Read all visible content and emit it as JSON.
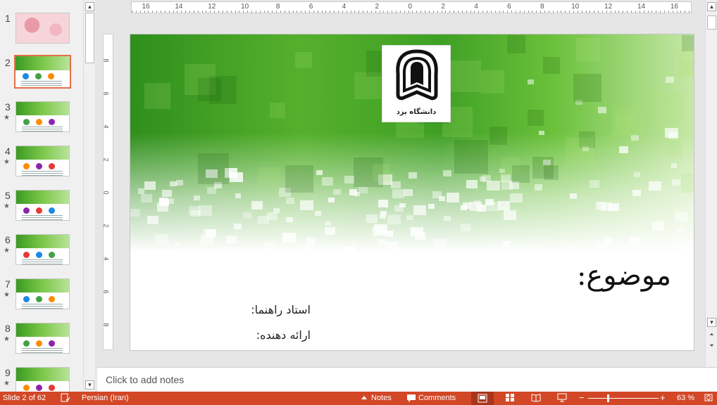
{
  "thumbnails": [
    {
      "num": "1",
      "star": "",
      "active": false,
      "style": "floral"
    },
    {
      "num": "2",
      "star": "",
      "active": true,
      "style": "title"
    },
    {
      "num": "3",
      "star": "★",
      "active": false,
      "style": "content"
    },
    {
      "num": "4",
      "star": "★",
      "active": false,
      "style": "content"
    },
    {
      "num": "5",
      "star": "★",
      "active": false,
      "style": "content"
    },
    {
      "num": "6",
      "star": "★",
      "active": false,
      "style": "content"
    },
    {
      "num": "7",
      "star": "★",
      "active": false,
      "style": "content"
    },
    {
      "num": "8",
      "star": "★",
      "active": false,
      "style": "content"
    },
    {
      "num": "9",
      "star": "★",
      "active": false,
      "style": "content"
    }
  ],
  "ruler_h_labels": [
    "16",
    "14",
    "12",
    "10",
    "8",
    "6",
    "4",
    "2",
    "0",
    "2",
    "4",
    "6",
    "8",
    "10",
    "12",
    "14",
    "16"
  ],
  "ruler_v_labels": [
    "8",
    "6",
    "4",
    "2",
    "0",
    "2",
    "4",
    "6",
    "8"
  ],
  "slide": {
    "logo_caption": "دانشگاه یزد",
    "title": "موضوع:",
    "advisor_label": "استاد راهنما:",
    "presenter_label": "ارائه دهنده:"
  },
  "notes_placeholder": "Click to add notes",
  "status": {
    "slide_info": "Slide 2 of 62",
    "language": "Persian (Iran)",
    "notes_label": "Notes",
    "comments_label": "Comments",
    "zoom": "63 %",
    "accent_color": "#d24726"
  }
}
